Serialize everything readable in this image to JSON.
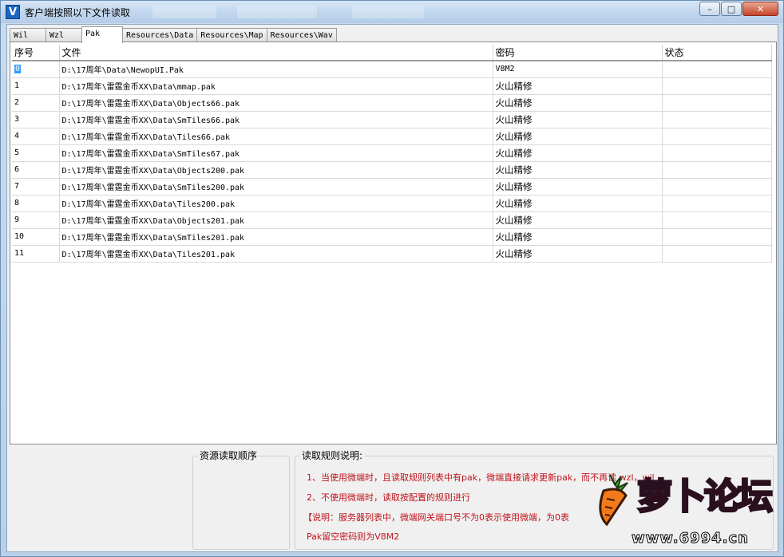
{
  "window": {
    "title": "客户端按照以下文件读取",
    "icon_letter": "V",
    "min_label": "–",
    "max_label": "□",
    "close_label": "✕"
  },
  "tabs": [
    {
      "label": "Wil"
    },
    {
      "label": "Wzl"
    },
    {
      "label": "Pak",
      "active": true
    },
    {
      "label": "Resources\\Data"
    },
    {
      "label": "Resources\\Map"
    },
    {
      "label": "Resources\\Wav"
    }
  ],
  "table": {
    "columns": [
      "序号",
      "文件",
      "密码",
      "状态"
    ],
    "rows": [
      {
        "index": "0",
        "file": "D:\\17周年\\Data\\NewopUI.Pak",
        "password": "V8M2",
        "status": ""
      },
      {
        "index": "1",
        "file": "D:\\17周年\\雷霆金币XX\\Data\\mmap.pak",
        "password": "火山精修",
        "status": ""
      },
      {
        "index": "2",
        "file": "D:\\17周年\\雷霆金币XX\\Data\\Objects66.pak",
        "password": "火山精修",
        "status": ""
      },
      {
        "index": "3",
        "file": "D:\\17周年\\雷霆金币XX\\Data\\SmTiles66.pak",
        "password": "火山精修",
        "status": ""
      },
      {
        "index": "4",
        "file": "D:\\17周年\\雷霆金币XX\\Data\\Tiles66.pak",
        "password": "火山精修",
        "status": ""
      },
      {
        "index": "5",
        "file": "D:\\17周年\\雷霆金币XX\\Data\\SmTiles67.pak",
        "password": "火山精修",
        "status": ""
      },
      {
        "index": "6",
        "file": "D:\\17周年\\雷霆金币XX\\Data\\Objects200.pak",
        "password": "火山精修",
        "status": ""
      },
      {
        "index": "7",
        "file": "D:\\17周年\\雷霆金币XX\\Data\\SmTiles200.pak",
        "password": "火山精修",
        "status": ""
      },
      {
        "index": "8",
        "file": "D:\\17周年\\雷霆金币XX\\Data\\Tiles200.pak",
        "password": "火山精修",
        "status": ""
      },
      {
        "index": "9",
        "file": "D:\\17周年\\雷霆金币XX\\Data\\Objects201.pak",
        "password": "火山精修",
        "status": ""
      },
      {
        "index": "10",
        "file": "D:\\17周年\\雷霆金币XX\\Data\\SmTiles201.pak",
        "password": "火山精修",
        "status": ""
      },
      {
        "index": "11",
        "file": "D:\\17周年\\雷霆金币XX\\Data\\Tiles201.pak",
        "password": "火山精修",
        "status": ""
      }
    ]
  },
  "order_group": {
    "title": "资源读取顺序"
  },
  "rules_group": {
    "title": "读取规则说明:",
    "lines": [
      "1、当使用微端时，且读取规则列表中有pak，微端直接请求更新pak，而不再读 wzl，wil",
      "2、不使用微端时，读取按配置的规则进行",
      "【说明：服务器列表中，微端网关端口号不为0表示使用微端，为0表",
      "Pak留空密码则为V8M2"
    ]
  },
  "watermark": {
    "text": "萝卜论坛",
    "url": "www.6994.cn"
  },
  "colors": {
    "selection": "#3399ff",
    "rule_text": "#c0141c",
    "watermark": "#c02a5e"
  }
}
